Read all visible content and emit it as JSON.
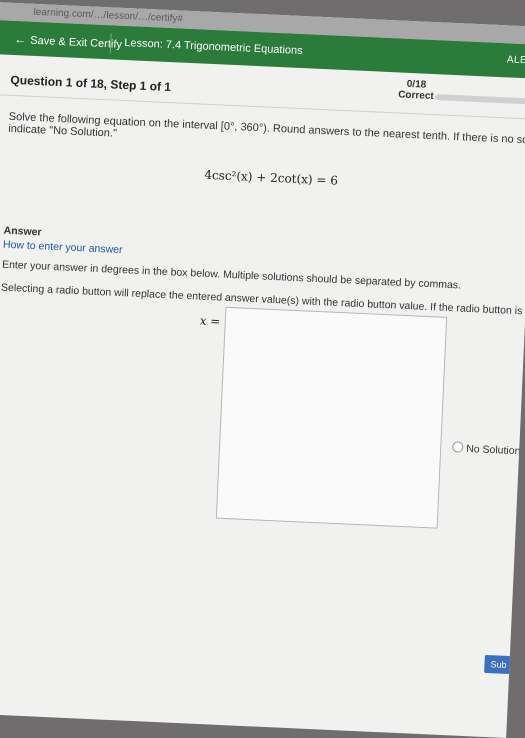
{
  "browser": {
    "url_fragment": "learning.com/…/lesson/…/certify#"
  },
  "nav": {
    "back_label": "Save & Exit Certify",
    "lesson_label": "Lesson: 7.4 Trigonometric Equations",
    "user_label": "ALEXA A"
  },
  "progress": {
    "question_label": "Question 1 of 18, Step 1 of 1",
    "score": "0/18",
    "status": "Correct",
    "fraction": 0
  },
  "problem": {
    "instruction": "Solve the following equation on the interval [0°, 360°). Round answers to the nearest tenth. If there is no solution, indicate \"No Solution.\"",
    "equation": "4csc²(x) + 2cot(x) = 6"
  },
  "answer": {
    "title": "Answer",
    "howto": "How to enter your answer",
    "line1": "Enter your answer in degrees in the box below. Multiple solutions should be separated by commas.",
    "line2": "Selecting a radio button will replace the entered answer value(s) with the radio button value. If the radio button is not selected, the entered answer is used",
    "x_label": "x =",
    "input_value": "",
    "no_solution_label": "No Solution"
  },
  "submit_label": "Sub",
  "colors": {
    "nav_bg": "#2b7b3a",
    "page_bg": "#f1f1f0",
    "link": "#1d5aa8"
  },
  "icons": {
    "back": "arrow-left-icon",
    "radio": "radio-icon"
  }
}
